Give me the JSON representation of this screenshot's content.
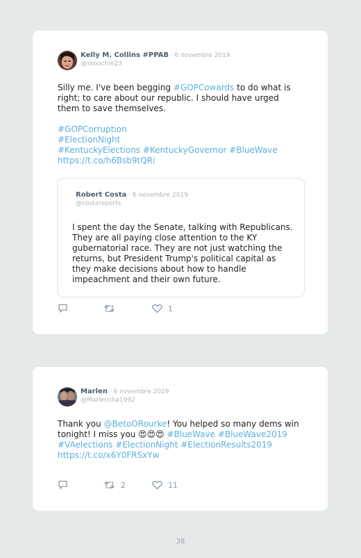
{
  "tweet1": {
    "name": "Kelly M. Collins #PPAB",
    "date": " · 6 novembre 2019",
    "handle": "@skoochie23",
    "text_a": "Silly me. I've been begging ",
    "text_link": "#GOPCowards",
    "text_b": " to do what is right; to care about our republic. I should have urged them to save themselves.",
    "tags": {
      "line1": "#GOPCorruption",
      "line2": "#ElectionNight",
      "line3": "#KentuckyElections #KentuckyGovernor #BlueWave",
      "url": "https://t.co/h6Bsb9tQRi"
    },
    "quote": {
      "name": "Robert Costa",
      "date": " · 6 novembre 2019",
      "handle": "@costareports",
      "text": "I spent the day the Senate, talking with Republicans. They are all paying close attention to the KY gubernatorial race. They are not just watching the returns, but President Trump's political capital as they make decisions about how to handle impeachment and their own future."
    },
    "retweets": "",
    "likes": "1"
  },
  "tweet2": {
    "name": "Marlen",
    "date": " · 6 novembre 2019",
    "handle": "@Marlencha1992",
    "text_a": "Thank you ",
    "mention": "@BetoORourke",
    "text_b": "! You helped so many dems win tonight! I miss you ",
    "emoji": "😍😍😍",
    "tags_inline": " #BlueWave #BlueWave2019",
    "tags_line": "#VAelections #ElectionNight #ElectionResults2019",
    "url": "https://t.co/x6Y0FRSxYw",
    "retweets": "2",
    "likes": "11"
  },
  "page_number": "38",
  "colors": {
    "link": "#5aaee0",
    "background": "#e6e9ea",
    "card": "#ffffff"
  },
  "icons": [
    "reply-icon",
    "retweet-icon",
    "like-icon"
  ]
}
